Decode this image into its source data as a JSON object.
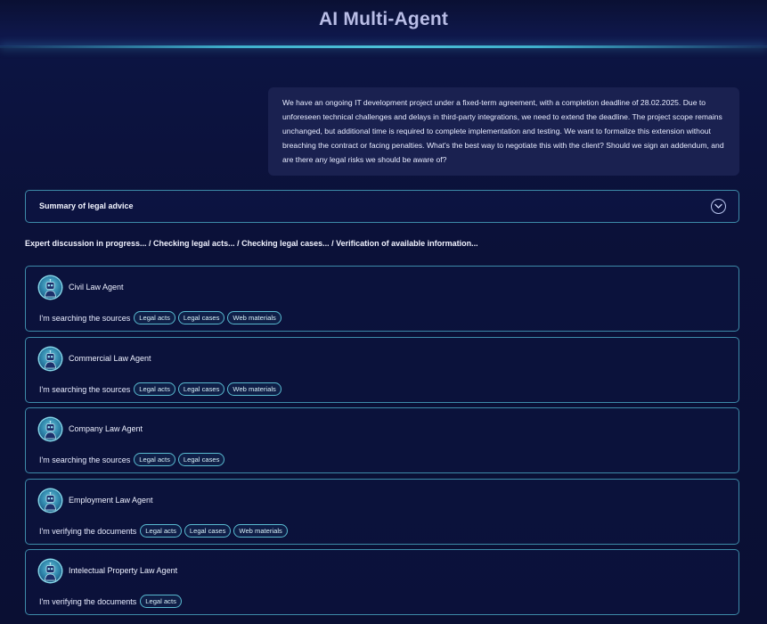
{
  "header": {
    "title": "AI Multi-Agent"
  },
  "user_message": "We have an ongoing IT development project under a fixed-term agreement, with a completion deadline of 28.02.2025. Due to unforeseen technical challenges and delays in third-party integrations, we need to extend the deadline. The project scope remains unchanged, but additional time is required to complete implementation and testing. We want to formalize this extension without breaching the contract or facing penalties. What's the best way to negotiate this with the client? Should we sign an addendum, and are there any legal risks we should be aware of?",
  "summary": {
    "title": "Summary of legal advice",
    "toggle_icon": "chevron-down-icon"
  },
  "progress_text": "Expert discussion in progress... / Checking legal acts... / Checking legal cases... / Verification of available information...",
  "agents": [
    {
      "name": "Civil Law Agent",
      "status": "I'm searching the sources",
      "tags": [
        "Legal acts",
        "Legal cases",
        "Web materials"
      ],
      "avatar_icon": "robot-avatar-icon"
    },
    {
      "name": "Commercial Law Agent",
      "status": "I'm searching the sources",
      "tags": [
        "Legal acts",
        "Legal cases",
        "Web materials"
      ],
      "avatar_icon": "robot-avatar-icon"
    },
    {
      "name": "Company Law Agent",
      "status": "I'm searching the sources",
      "tags": [
        "Legal acts",
        "Legal cases"
      ],
      "avatar_icon": "robot-avatar-icon"
    },
    {
      "name": "Employment Law Agent",
      "status": "I'm verifying the documents",
      "tags": [
        "Legal acts",
        "Legal cases",
        "Web materials"
      ],
      "avatar_icon": "robot-avatar-icon"
    },
    {
      "name": "Intelectual Property Law Agent",
      "status": "I'm verifying the documents",
      "tags": [
        "Legal acts"
      ],
      "avatar_icon": "robot-avatar-icon"
    }
  ],
  "colors": {
    "background": "#0b1037",
    "accent": "#3fb0cc",
    "card_border": "#3d8aa8",
    "bubble": "#1a2150"
  }
}
